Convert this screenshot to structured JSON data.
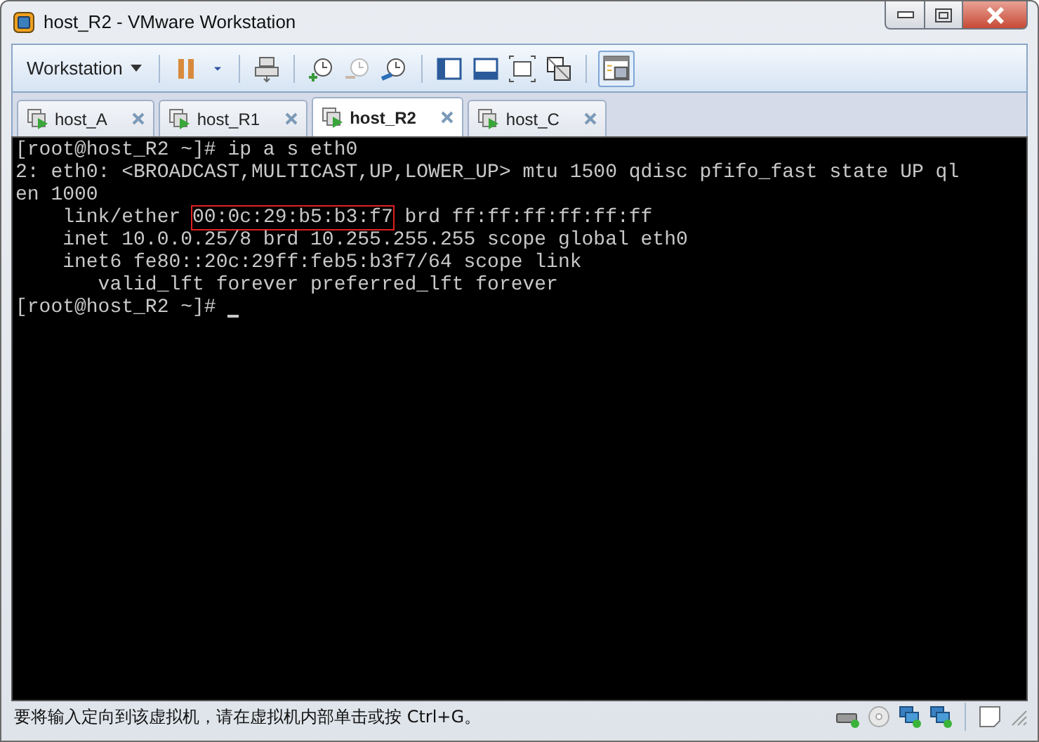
{
  "window": {
    "title": "host_R2 - VMware Workstation"
  },
  "toolbar": {
    "menu": "Workstation"
  },
  "tabs": [
    {
      "label": "host_A",
      "selected": false
    },
    {
      "label": "host_R1",
      "selected": false
    },
    {
      "label": "host_R2",
      "selected": true
    },
    {
      "label": "host_C",
      "selected": false
    }
  ],
  "terminal": {
    "lines": [
      {
        "segments": [
          {
            "text": "[root@host_R2 ~]# ip a s eth0",
            "highlighted": false
          }
        ]
      },
      {
        "segments": [
          {
            "text": "2: eth0: <BROADCAST,MULTICAST,UP,LOWER_UP> mtu 1500 qdisc pfifo_fast state UP ql",
            "highlighted": false
          }
        ]
      },
      {
        "segments": [
          {
            "text": "en 1000",
            "highlighted": false
          }
        ]
      },
      {
        "segments": [
          {
            "text": "    link/ether ",
            "highlighted": false
          },
          {
            "text": "00:0c:29:b5:b3:f7",
            "highlighted": true
          },
          {
            "text": " brd ff:ff:ff:ff:ff:ff",
            "highlighted": false
          }
        ]
      },
      {
        "segments": [
          {
            "text": "    inet 10.0.0.25/8 brd 10.255.255.255 scope global eth0",
            "highlighted": false
          }
        ]
      },
      {
        "segments": [
          {
            "text": "    inet6 fe80::20c:29ff:feb5:b3f7/64 scope link",
            "highlighted": false
          }
        ]
      },
      {
        "segments": [
          {
            "text": "       valid_lft forever preferred_lft forever",
            "highlighted": false
          }
        ]
      },
      {
        "segments": [
          {
            "text": "[root@host_R2 ~]# ",
            "highlighted": false
          }
        ],
        "cursor": true
      }
    ]
  },
  "status_bar": {
    "message": "要将输入定向到该虚拟机，请在虚拟机内部单击或按 Ctrl+G。"
  }
}
